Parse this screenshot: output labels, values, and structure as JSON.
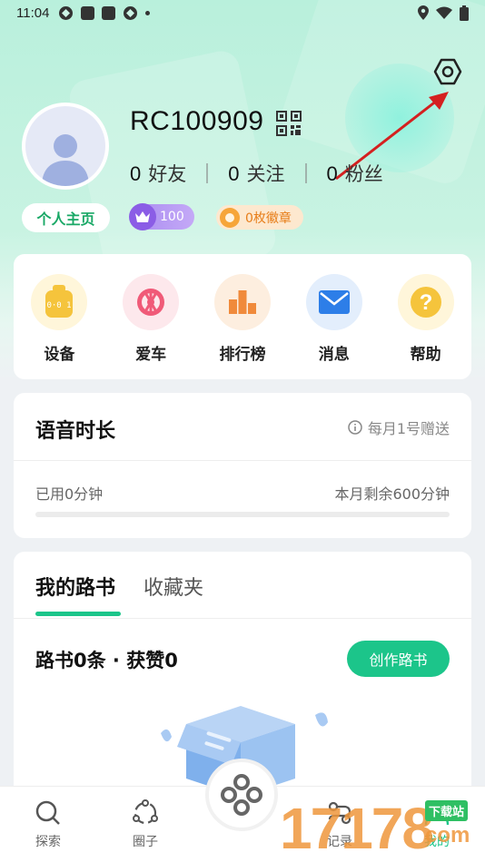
{
  "status_bar": {
    "time": "11:04"
  },
  "profile": {
    "username": "RC100909",
    "stats": [
      {
        "count": "0",
        "label": "好友"
      },
      {
        "count": "0",
        "label": "关注"
      },
      {
        "count": "0",
        "label": "粉丝"
      }
    ],
    "homepage_label": "个人主页",
    "level_value": "100",
    "medal_label": "0枚徽章"
  },
  "tools": [
    {
      "label": "设备",
      "icon": "device-icon",
      "color": "#f5c43c"
    },
    {
      "label": "爱车",
      "icon": "steering-wheel-icon",
      "color": "#f05a78"
    },
    {
      "label": "排行榜",
      "icon": "leaderboard-icon",
      "color": "#f08a3b"
    },
    {
      "label": "消息",
      "icon": "mail-icon",
      "color": "#2d7ee8"
    },
    {
      "label": "帮助",
      "icon": "help-icon",
      "color": "#f5c43c"
    }
  ],
  "voice": {
    "title": "语音时长",
    "note": "每月1号赠送",
    "used": "已用0分钟",
    "remaining": "本月剩余600分钟",
    "progress_fraction": 0
  },
  "routes": {
    "tabs": [
      "我的路书",
      "收藏夹"
    ],
    "summary": "路书0条 · 获赞0",
    "create_label": "创作路书"
  },
  "tabbar": {
    "items": [
      {
        "label": "探索",
        "icon": "search-icon"
      },
      {
        "label": "圈子",
        "icon": "circle-icon"
      },
      {
        "label": "记录",
        "icon": "record-icon"
      },
      {
        "label": "我的",
        "icon": "profile-icon"
      }
    ]
  },
  "watermark": {
    "digits": "17178",
    "tag": "下载站",
    "domain": "com"
  },
  "colors": {
    "accent": "#1cc58a",
    "header_bg": "#b9f0dc"
  }
}
